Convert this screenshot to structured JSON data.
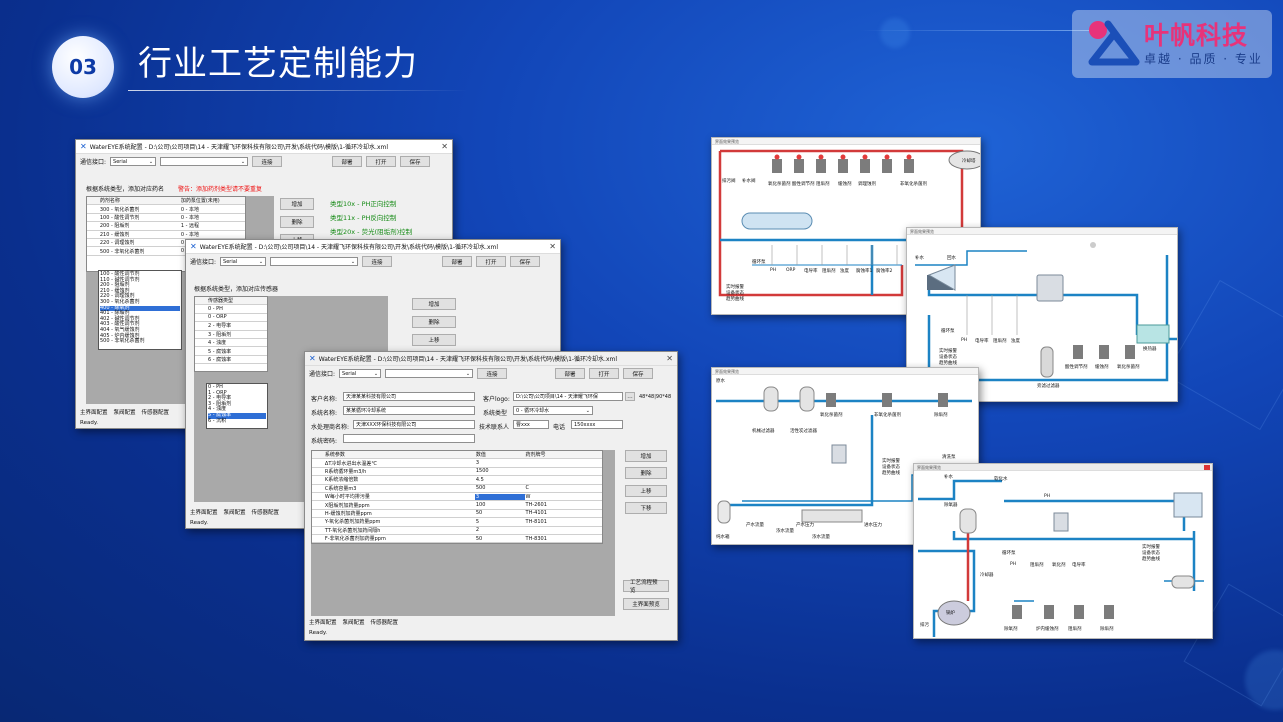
{
  "header": {
    "section_number": "03",
    "title": "行业工艺定制能力"
  },
  "logo": {
    "name": "叶帆科技",
    "slogan": "卓越 · 品质 · 专业"
  },
  "win1": {
    "title": "WaterEYE系统配置 - D:\\公司\\公司项目\\14 - 天津耀飞环保科技有限公司\\开发\\系统代码\\模版\\1-循环冷却水.xml",
    "port_label": "通信接口:",
    "port_value": "Serial",
    "connect": "连接",
    "deploy": "部署",
    "open": "打开",
    "save": "保存",
    "instruction": "根据系统类型，添加对应药名",
    "warning": "警告：添加药剂类型请不要重复",
    "col1": "药剂名称",
    "col2": "加药泵位置(未用)",
    "rows": [
      {
        "a": "300 - 氧化杀菌剂",
        "b": "0 - 本地"
      },
      {
        "a": "100 - 酸性调节剂",
        "b": "0 - 本地"
      },
      {
        "a": "200 - 阻垢剂",
        "b": "1 - 远程"
      },
      {
        "a": "210 - 缓蚀剂",
        "b": "0 - 本地"
      },
      {
        "a": "220 - 调理蚀剂",
        "b": "0 - 本地"
      },
      {
        "a": "500 - 非氧化杀菌剂",
        "b": "0"
      }
    ],
    "dropdown": [
      "100 - 酸性调节剂",
      "110 - 碱性调节剂",
      "200 - 阻垢剂",
      "210 - 缓蚀剂",
      "220 - 调理蚀剂",
      "300 - 氧化杀菌剂",
      "400 - 除氧剂",
      "401 - 除垢剂",
      "402 - 碱性调节剂",
      "403 - 酸性调节剂",
      "404 - 氧气缓蚀剂",
      "405 - 炉内缓蚀剂",
      "500 - 非氧化杀菌剂"
    ],
    "dropdown_selected": 6,
    "add": "增加",
    "delete": "删除",
    "up": "上移",
    "notes": [
      "类型10x - PH正向控制",
      "类型11x - PH反向控制",
      "类型20x - 荧光(阻垢剂)控制"
    ],
    "tabs": [
      "主界面配置",
      "泵阀配置",
      "传感器配置"
    ],
    "status": "Ready."
  },
  "win2": {
    "title": "WaterEYE系统配置 - D:\\公司\\公司项目\\14 - 天津耀飞环保科技有限公司\\开发\\系统代码\\模版\\1-循环冷却水.xml",
    "port_label": "通信接口:",
    "port_value": "Serial",
    "connect": "连接",
    "deploy": "部署",
    "open": "打开",
    "save": "保存",
    "instruction": "根据系统类型，添加对应传感器",
    "col1": "传感器类型",
    "rows": [
      "0 - PH",
      "0 - ORP",
      "2 - 电导率",
      "3 - 阻垢剂",
      "4 - 浊度",
      "5 - 腐蚀率",
      "6 - 腐蚀率"
    ],
    "dropdown": [
      "0 - PH",
      "1 - ORP",
      "2 - 电导率",
      "3 - 阻垢剂",
      "4 - 浊度",
      "5 - 腐蚀率",
      "6 - 沉积"
    ],
    "dropdown_selected": 5,
    "add": "增加",
    "delete": "删除",
    "up": "上移",
    "tabs": [
      "主界面配置",
      "泵阀配置",
      "传感器配置"
    ],
    "status": "Ready."
  },
  "win3": {
    "title": "WaterEYE系统配置 - D:\\公司\\公司项目\\14 - 天津耀飞环保科技有限公司\\开发\\系统代码\\模版\\1-循环冷却水.xml",
    "port_label": "通信接口:",
    "port_value": "Serial",
    "connect": "连接",
    "deploy": "部署",
    "open": "打开",
    "save": "保存",
    "customer_label": "客户名称:",
    "customer": "天津某某科技有限公司",
    "logo_label": "客户logo:",
    "logo_path": "D:\\公司\\公司项目\\14 - 天津耀飞环保",
    "logo_size": "48*48|90*48",
    "sysname_label": "系统名称:",
    "sysname": "某某循环冷却系统",
    "systype_label": "系统类型",
    "systype": "0 - 循环冷却水",
    "provider_label": "水处理商名称:",
    "provider": "天津XXX环保科技有限公司",
    "contact_label": "技术联系人",
    "contact": "曹xxx",
    "phone_label": "电话",
    "phone": "150xxxx",
    "password_label": "系统密码:",
    "cols": [
      "系统参数",
      "数值",
      "药剂牌号"
    ],
    "rows": [
      {
        "p": "ΔT冷却水进出水温差℃",
        "v": "3",
        "c": ""
      },
      {
        "p": "R系统循环量m3/h",
        "v": "1500",
        "c": ""
      },
      {
        "p": "K系统浓缩倍数",
        "v": "4.5",
        "c": ""
      },
      {
        "p": "C系统容量m3",
        "v": "500",
        "c": "C"
      },
      {
        "p": "W每小时平均排污量",
        "v": "3",
        "c": "W"
      },
      {
        "p": "X阻垢剂加药量ppm",
        "v": "100",
        "c": "TH-2601"
      },
      {
        "p": "H-缓蚀剂加药量ppm",
        "v": "50",
        "c": "TH-4101"
      },
      {
        "p": "Y-氧化杀菌剂加药量ppm",
        "v": "5",
        "c": "TH-8101"
      },
      {
        "p": "TT-氧化杀菌剂加药间隔h",
        "v": "2",
        "c": ""
      },
      {
        "p": "F-非氧化杀菌剂加药量ppm",
        "v": "50",
        "c": "TH-8301"
      }
    ],
    "add": "增加",
    "delete": "删除",
    "up": "上移",
    "down": "下移",
    "preview1": "工艺流程预览",
    "preview2": "主界面预览",
    "tabs": [
      "主界面配置",
      "泵阀配置",
      "传感器配置"
    ],
    "status": "Ready."
  },
  "hmi1": {
    "top": "界面效果预览",
    "labels": [
      "排污阀",
      "补水阀",
      "氧化杀菌剂",
      "酸性调节剂",
      "阻垢剂",
      "缓蚀剂",
      "调理蚀剂",
      "非氧化杀菌剂",
      "冷却塔",
      "循环泵",
      "PH",
      "ORP",
      "电导率",
      "阻垢剂",
      "浊度",
      "腐蚀率1",
      "腐蚀率2",
      "实时报警",
      "设备状态",
      "趋势曲线"
    ]
  },
  "hmi2": {
    "top": "界面效果预览",
    "labels": [
      "补水",
      "回水",
      "PH",
      "电导率",
      "阻垢剂",
      "浊度",
      "循环泵",
      "实时报警",
      "设备状态",
      "趋势曲线",
      "旁滤过滤器",
      "酸性调节剂",
      "缓蚀剂",
      "氧化杀菌剂",
      "换热器"
    ]
  },
  "hmi3": {
    "top": "界面效果预览",
    "labels": [
      "原水",
      "机械过滤器",
      "活性炭过滤器",
      "氧化杀菌剂",
      "非氧化杀菌剂",
      "除垢剂",
      "纯水箱",
      "产水流量",
      "浓水流量",
      "产水压力",
      "进水压力",
      "浓水流量",
      "清洗泵",
      "实时报警",
      "设备状态",
      "趋势曲线"
    ]
  },
  "hmi4": {
    "top": "界面效果预览",
    "labels": [
      "补水",
      "软化水",
      "PH",
      "除氧器",
      "冷却器",
      "循环泵",
      "PH",
      "阻垢剂",
      "氧化剂",
      "电导率",
      "除氧剂",
      "炉内缓蚀剂",
      "阻垢剂",
      "除垢剂",
      "实时报警",
      "设备状态",
      "趋势曲线",
      "排污",
      "锅炉"
    ]
  }
}
